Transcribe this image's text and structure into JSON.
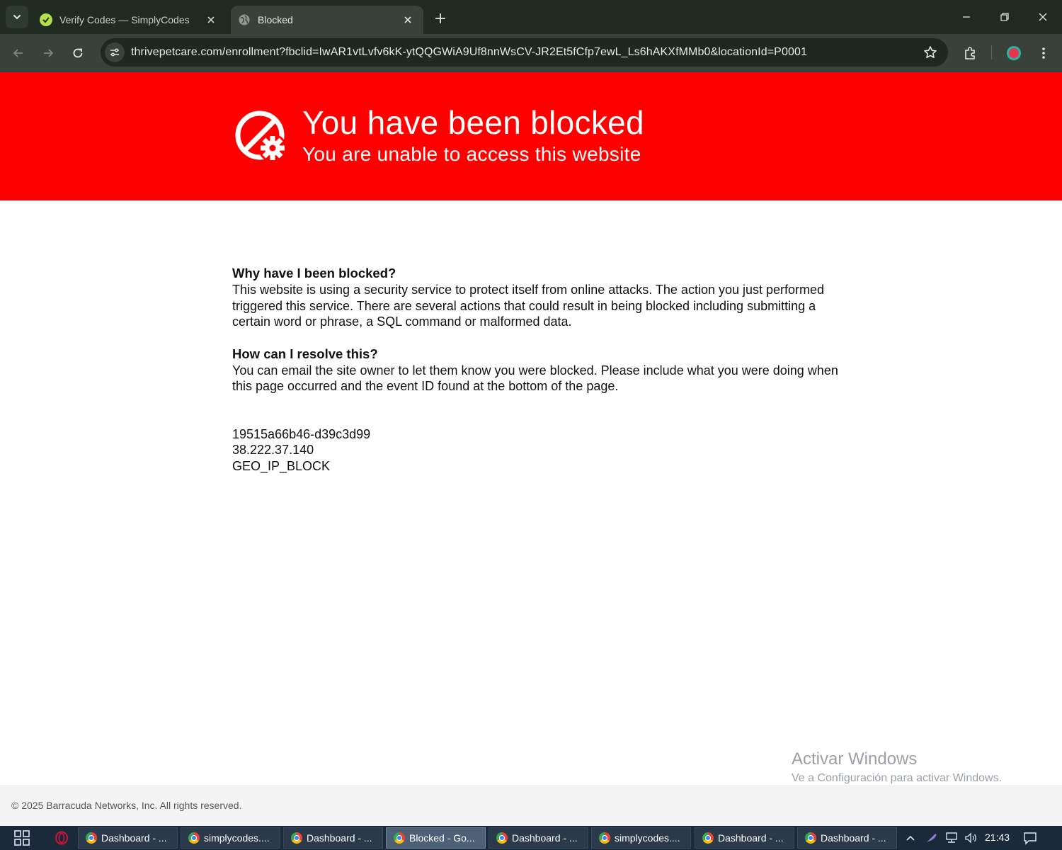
{
  "browser": {
    "tabs": [
      {
        "title": "Verify Codes — SimplyCodes",
        "active": false,
        "favicon": "simplycodes-icon"
      },
      {
        "title": "Blocked",
        "active": true,
        "favicon": "globe-icon"
      }
    ],
    "url": "thrivepetcare.com/enrollment?fbclid=IwAR1vtLvfv6kK-ytQQGWiA9Uf8nnWsCV-JR2Et5fCfp7ewL_Ls6hAKXfMMb0&locationId=P0001"
  },
  "page": {
    "banner": {
      "title": "You have been blocked",
      "subtitle": "You are unable to access this website",
      "background": "#ff0000"
    },
    "why": {
      "heading": "Why have I been blocked?",
      "body": "This website is using a security service to protect itself from online attacks. The action you just performed triggered this service. There are several actions that could result in being blocked including submitting a certain word or phrase, a SQL command or malformed data."
    },
    "resolve": {
      "heading": "How can I resolve this?",
      "body": "You can email the site owner to let them know you were blocked. Please include what you were doing when this page occurred and the event ID found at the bottom of the page."
    },
    "event": {
      "id": "19515a66b46-d39c3d99",
      "ip": "38.222.37.140",
      "reason": "GEO_IP_BLOCK"
    },
    "footer": "© 2025 Barracuda Networks, Inc. All rights reserved."
  },
  "watermark": {
    "title": "Activar Windows",
    "subtitle": "Ve a Configuración para activar Windows."
  },
  "taskbar": {
    "items": [
      {
        "label": "Dashboard - ...",
        "active": false
      },
      {
        "label": "simplycodes....",
        "active": false
      },
      {
        "label": "Dashboard - ...",
        "active": false
      },
      {
        "label": "Blocked - Go...",
        "active": true
      },
      {
        "label": "Dashboard - ...",
        "active": false
      },
      {
        "label": "simplycodes....",
        "active": false
      },
      {
        "label": "Dashboard - ...",
        "active": false
      },
      {
        "label": "Dashboard - ...",
        "active": false
      }
    ],
    "clock": "21:43"
  }
}
